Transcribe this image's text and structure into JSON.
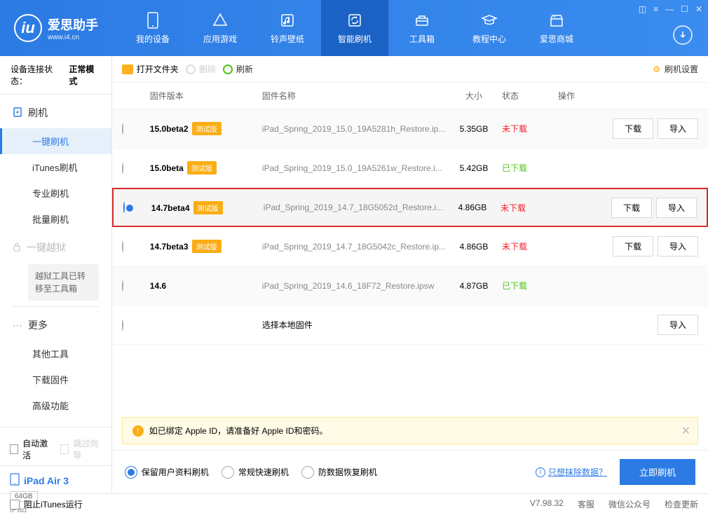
{
  "app": {
    "name": "爱思助手",
    "url": "www.i4.cn"
  },
  "nav": {
    "items": [
      {
        "label": "我的设备",
        "icon": "phone"
      },
      {
        "label": "应用游戏",
        "icon": "appstore"
      },
      {
        "label": "铃声壁纸",
        "icon": "music"
      },
      {
        "label": "智能刷机",
        "icon": "refresh",
        "active": true
      },
      {
        "label": "工具箱",
        "icon": "toolbox"
      },
      {
        "label": "教程中心",
        "icon": "graduation"
      },
      {
        "label": "爱思商城",
        "icon": "shop"
      }
    ]
  },
  "connection": {
    "label": "设备连接状态：",
    "status": "正常模式"
  },
  "sidebar": {
    "flash_head": "刷机",
    "flash_items": {
      "onekey": "一键刷机",
      "itunes": "iTunes刷机",
      "pro": "专业刷机",
      "batch": "批量刷机"
    },
    "jailbreak": "一键越狱",
    "jb_note": "越狱工具已转移至工具箱",
    "more_head": "更多",
    "more_items": {
      "other_tools": "其他工具",
      "download_fw": "下载固件",
      "advanced": "高级功能"
    },
    "auto_activate": "自动激活",
    "skip_guide": "跳过向导",
    "block_itunes": "阻止iTunes运行"
  },
  "device": {
    "name": "iPad Air 3",
    "storage": "64GB",
    "type": "iPad"
  },
  "toolbar": {
    "open_folder": "打开文件夹",
    "delete": "删除",
    "refresh": "刷新",
    "settings": "刷机设置"
  },
  "table": {
    "headers": {
      "version": "固件版本",
      "name": "固件名称",
      "size": "大小",
      "status": "状态",
      "ops": "操作"
    },
    "btn_download": "下载",
    "btn_import": "导入",
    "local_fw": "选择本地固件",
    "tag_beta": "测试版",
    "status_not": "未下载",
    "status_done": "已下载",
    "rows": [
      {
        "ver": "15.0beta2",
        "beta": true,
        "name": "iPad_Spring_2019_15.0_19A5281h_Restore.ip...",
        "size": "5.35GB",
        "status": "not",
        "ops": true
      },
      {
        "ver": "15.0beta",
        "beta": true,
        "name": "iPad_Spring_2019_15.0_19A5261w_Restore.i...",
        "size": "5.42GB",
        "status": "done",
        "ops": false
      },
      {
        "ver": "14.7beta4",
        "beta": true,
        "name": "iPad_Spring_2019_14.7_18G5052d_Restore.i...",
        "size": "4.86GB",
        "status": "not",
        "ops": true,
        "selected": true,
        "highlight": true
      },
      {
        "ver": "14.7beta3",
        "beta": true,
        "name": "iPad_Spring_2019_14.7_18G5042c_Restore.ip...",
        "size": "4.86GB",
        "status": "not",
        "ops": true
      },
      {
        "ver": "14.6",
        "beta": false,
        "name": "iPad_Spring_2019_14.6_18F72_Restore.ipsw",
        "size": "4.87GB",
        "status": "done",
        "ops": false
      }
    ]
  },
  "note": {
    "text": "如已绑定 Apple ID，请准备好 Apple ID和密码。"
  },
  "options": {
    "opt1": "保留用户资料刷机",
    "opt2": "常规快速刷机",
    "opt3": "防数据恢复刷机",
    "erase_link": "只想抹除数据？",
    "flash_now": "立即刷机"
  },
  "statusbar": {
    "version": "V7.98.32",
    "service": "客服",
    "wechat": "微信公众号",
    "update": "检查更新"
  }
}
